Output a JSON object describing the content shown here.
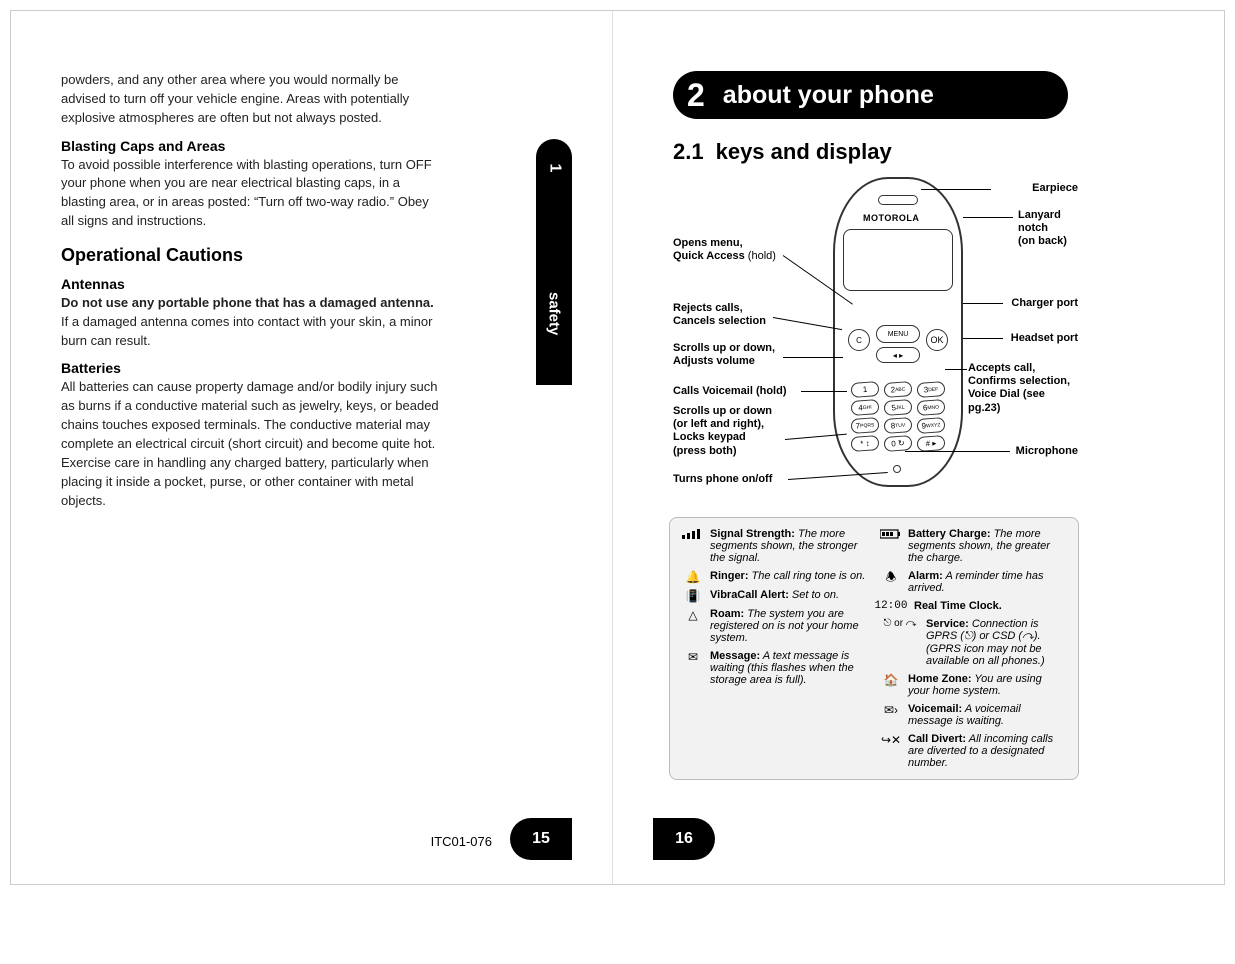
{
  "left_page": {
    "intro_para": "powders, and any other area where you would normally be advised to turn off your vehicle engine. Areas with potentially explosive atmospheres are often but not always posted.",
    "blasting_h": "Blasting Caps and Areas",
    "blasting_p": "To avoid possible interference with blasting operations, turn OFF your phone when you are near electrical blasting caps, in a blasting area, or in areas posted: “Turn off two-way radio.” Obey all signs and instructions.",
    "operational_h": "Operational Cautions",
    "antennas_h": "Antennas",
    "antennas_bold": "Do not use any portable phone that has a damaged antenna.",
    "antennas_rest": " If a damaged antenna comes into contact with your skin, a minor burn can result.",
    "batteries_h": "Batteries",
    "batteries_p": "All batteries can cause property damage and/or bodily injury such as burns if a conductive material such as jewelry, keys, or beaded chains touches exposed terminals. The conductive material may complete an electrical circuit (short circuit) and become quite hot. Exercise care in handling any charged battery, particularly when placing it inside a pocket, purse, or other container with metal objects.",
    "footer_code": "ITC01-076",
    "page_no": "15",
    "tab_num": "1",
    "tab_label": "safety"
  },
  "right_page": {
    "page_no": "16",
    "chap_num": "2",
    "chap_title": "about your phone",
    "sec_num": "2.1",
    "sec_title": "keys and display",
    "brand": "MOTOROLA",
    "callouts": {
      "earpiece": "Earpiece",
      "lanyard1": "Lanyard",
      "lanyard2": "notch",
      "lanyard3": "(on back)",
      "charger": "Charger port",
      "headset": "Headset port",
      "accept1": "Accepts call,",
      "accept2": "Confirms selection,",
      "accept3": "Voice Dial (see pg.23)",
      "microphone": "Microphone",
      "opens1": "Opens menu,",
      "opens2": "Quick Access",
      "opens2b": " (hold)",
      "rejects1": "Rejects calls,",
      "rejects2": "Cancels selection",
      "scrolls1a": "Scrolls up or down,",
      "scrolls1b": "Adjusts volume",
      "voicemail": "Calls Voicemail (hold)",
      "scrolls2a": "Scrolls up or down",
      "scrolls2b": "(or left and right),",
      "scrolls2c": "Locks keypad",
      "scrolls2d": "(press both)",
      "power": "Turns phone on/off"
    },
    "icons_left": [
      {
        "label": "Signal Strength:",
        "desc": " The more segments shown, the stronger the signal.",
        "glyph": "signal"
      },
      {
        "label": "Ringer:",
        "desc": " The call ring tone is on.",
        "glyph": "🔔"
      },
      {
        "label": "VibraCall Alert:",
        "desc": " Set to on.",
        "glyph": "📳"
      },
      {
        "label": "Roam:",
        "desc": " The system you are registered on is not your home system.",
        "glyph": "△"
      },
      {
        "label": "Message:",
        "desc": " A text message is waiting (this flashes when the storage area is full).",
        "glyph": "✉"
      }
    ],
    "icons_right": [
      {
        "label": "Battery Charge:",
        "desc": " The more segments shown, the greater the charge.",
        "glyph": "battery"
      },
      {
        "label": "Alarm:",
        "desc": " A reminder time has arrived.",
        "glyph": "🕭"
      },
      {
        "label": "Real Time Clock.",
        "desc": "",
        "glyph": "12:00"
      },
      {
        "label": "Service:",
        "desc": " Connection is GPRS (⎋) or CSD (↷). (GPRS icon may not be available on all phones.)",
        "glyph": "service"
      },
      {
        "label": "Home Zone:",
        "desc": " You are using your home system.",
        "glyph": "🏠"
      },
      {
        "label": "Voicemail:",
        "desc": " A voicemail message is waiting.",
        "glyph": "✉›"
      },
      {
        "label": "Call Divert:",
        "desc": " All incoming calls are diverted to a designated number.",
        "glyph": "↪✕"
      }
    ]
  }
}
